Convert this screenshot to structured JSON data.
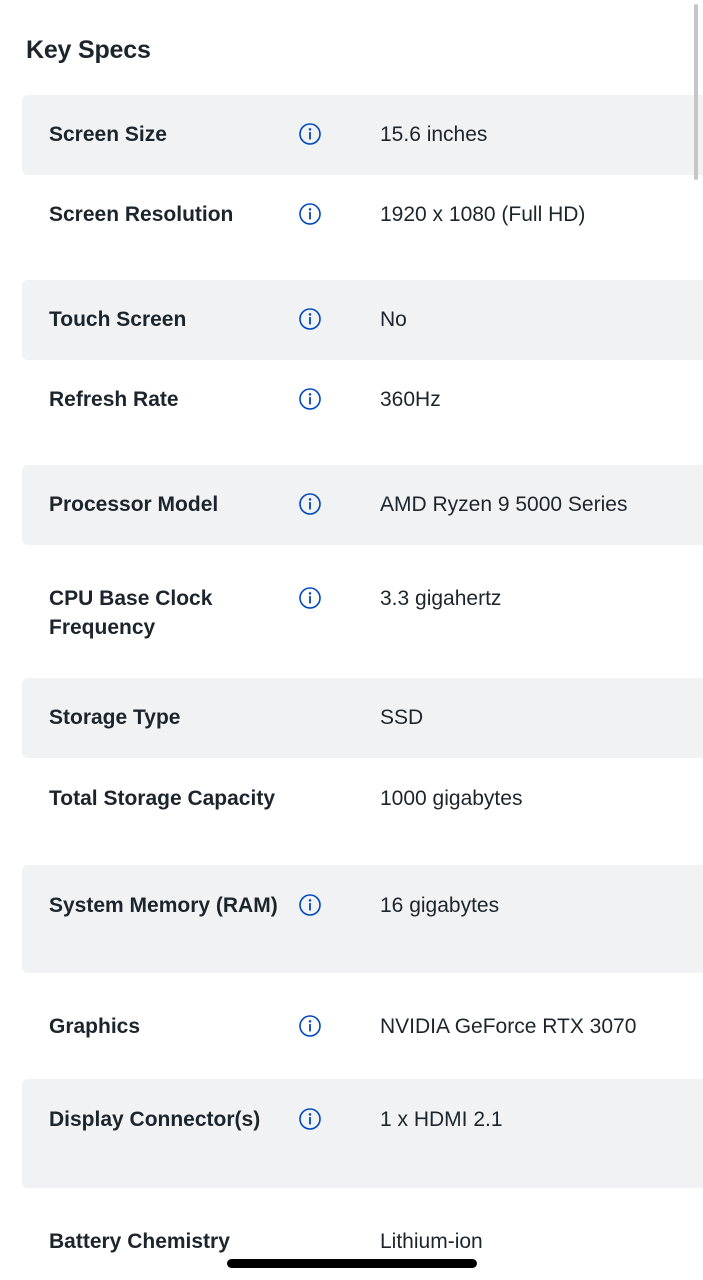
{
  "section": {
    "title": "Key Specs"
  },
  "specs": [
    {
      "label": "Screen Size",
      "value": "15.6 inches",
      "has_info": true
    },
    {
      "label": "Screen Resolution",
      "value": "1920 x 1080 (Full HD)",
      "has_info": true
    },
    {
      "label": "Touch Screen",
      "value": "No",
      "has_info": true
    },
    {
      "label": "Refresh Rate",
      "value": "360Hz",
      "has_info": true
    },
    {
      "label": "Processor Model",
      "value": "AMD Ryzen 9 5000 Series",
      "has_info": true
    },
    {
      "label": "CPU Base Clock Frequency",
      "value": "3.3 gigahertz",
      "has_info": true
    },
    {
      "label": "Storage Type",
      "value": "SSD",
      "has_info": false
    },
    {
      "label": "Total Storage Capacity",
      "value": "1000 gigabytes",
      "has_info": false
    },
    {
      "label": "System Memory (RAM)",
      "value": "16 gigabytes",
      "has_info": true
    },
    {
      "label": "Graphics",
      "value": "NVIDIA GeForce RTX 3070",
      "has_info": true
    },
    {
      "label": "Display Connector(s)",
      "value": "1 x HDMI 2.1",
      "has_info": true
    },
    {
      "label": "Battery Chemistry",
      "value": "Lithium-ion",
      "has_info": false
    }
  ],
  "colors": {
    "row_shade": "#f0f2f4",
    "info_icon": "#0046be",
    "text": "#1d252c"
  },
  "icons": {
    "info": "info-circle-icon"
  }
}
